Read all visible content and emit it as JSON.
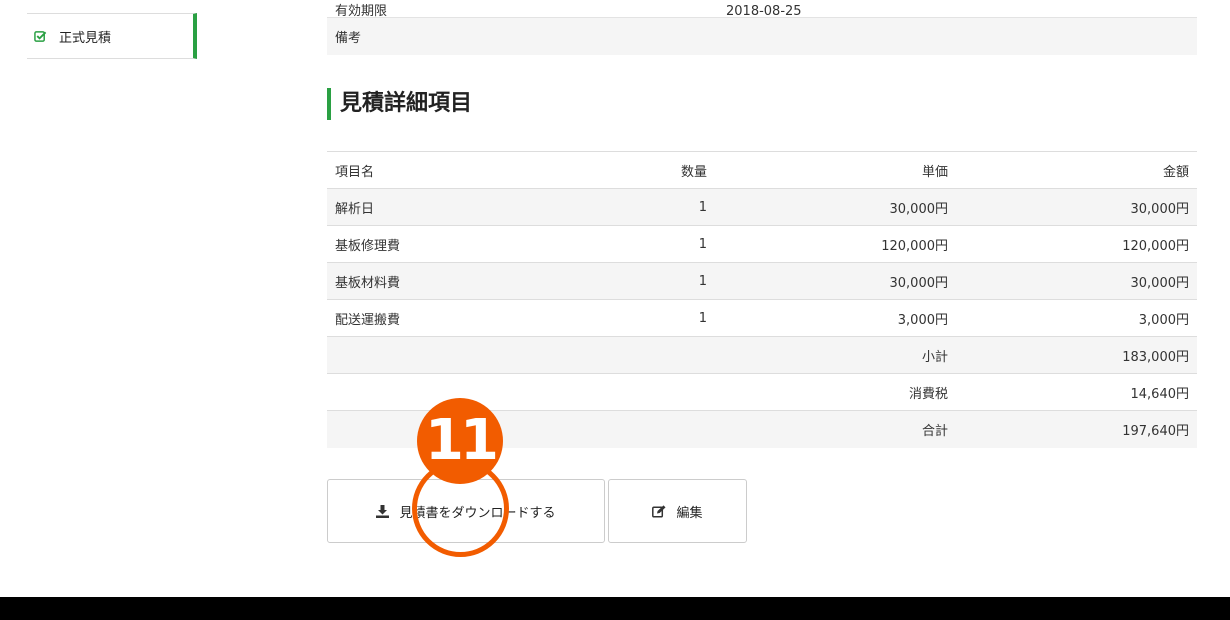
{
  "sidebar": {
    "items": [
      {
        "label": "正式見積",
        "icon": "check-square-icon",
        "active": true
      }
    ]
  },
  "details": {
    "rows": [
      {
        "label": "有効期限",
        "value": "2018-08-25"
      },
      {
        "label": "備考",
        "value": ""
      }
    ]
  },
  "section": {
    "title": "見積詳細項目"
  },
  "table": {
    "headers": [
      "項目名",
      "数量",
      "単価",
      "金額"
    ],
    "rows": [
      [
        "解析日",
        "1",
        "30,000円",
        "30,000円"
      ],
      [
        "基板修理費",
        "1",
        "120,000円",
        "120,000円"
      ],
      [
        "基板材料費",
        "1",
        "30,000円",
        "30,000円"
      ],
      [
        "配送運搬費",
        "1",
        "3,000円",
        "3,000円"
      ]
    ],
    "summary": [
      {
        "label": "小計",
        "value": "183,000円"
      },
      {
        "label": "消費税",
        "value": "14,640円"
      },
      {
        "label": "合計",
        "value": "197,640円"
      }
    ]
  },
  "actions": {
    "download_label": "見積書をダウンロードする",
    "edit_label": "編集"
  },
  "annotation": {
    "number": "11",
    "color": "#f25c00"
  },
  "colors": {
    "accent": "#2aa043"
  }
}
